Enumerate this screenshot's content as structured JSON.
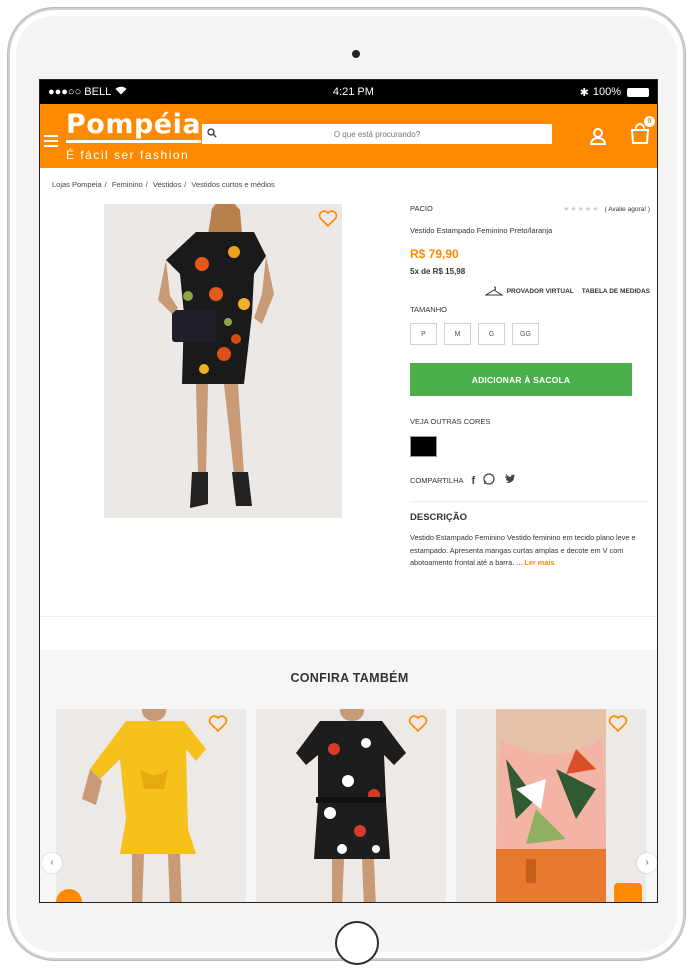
{
  "status_bar": {
    "carrier": "●●●○○ BELL",
    "time": "4:21 PM",
    "battery": "100%"
  },
  "header": {
    "logo": "Pompéia",
    "tagline": "É fácil ser fashion",
    "search_placeholder": "O que está procurando?",
    "cart_count": "0"
  },
  "breadcrumb": [
    "Lojas Pompeia",
    "Feminino",
    "Vestidos",
    "Vestidos curtos e médios"
  ],
  "product": {
    "brand": "PACIO",
    "stars": "★★★★★",
    "rate_link": "( Avalie agora! )",
    "name": "Vestido Estampado Feminino Preto/laranja",
    "price": "R$ 79,90",
    "installments": "5x de R$ 15,98",
    "virtual_fitting": "PROVADOR VIRTUAL",
    "size_chart": "TABELA DE MEDIDAS",
    "size_label": "TAMANHO",
    "sizes": [
      "P",
      "M",
      "G",
      "GG"
    ],
    "add_to_bag": "ADICIONAR À SACOLA",
    "colors_label": "VEJA OUTRAS CORES",
    "color_swatch": "#000000",
    "share_label": "COMPARTILHA",
    "description_title": "DESCRIÇÃO",
    "description": "Vestido Estampado Feminino Vestido feminino em tecido plano leve e estampado. Apresenta mangas curtas amplas e decote em V com abotoamento frontal até a barra. ...",
    "read_more": "Ler mais"
  },
  "also_section": {
    "title": "CONFIRA TAMBÉM"
  },
  "colors": {
    "brand_orange": "#ff8a00",
    "add_green": "#4bb04b"
  }
}
